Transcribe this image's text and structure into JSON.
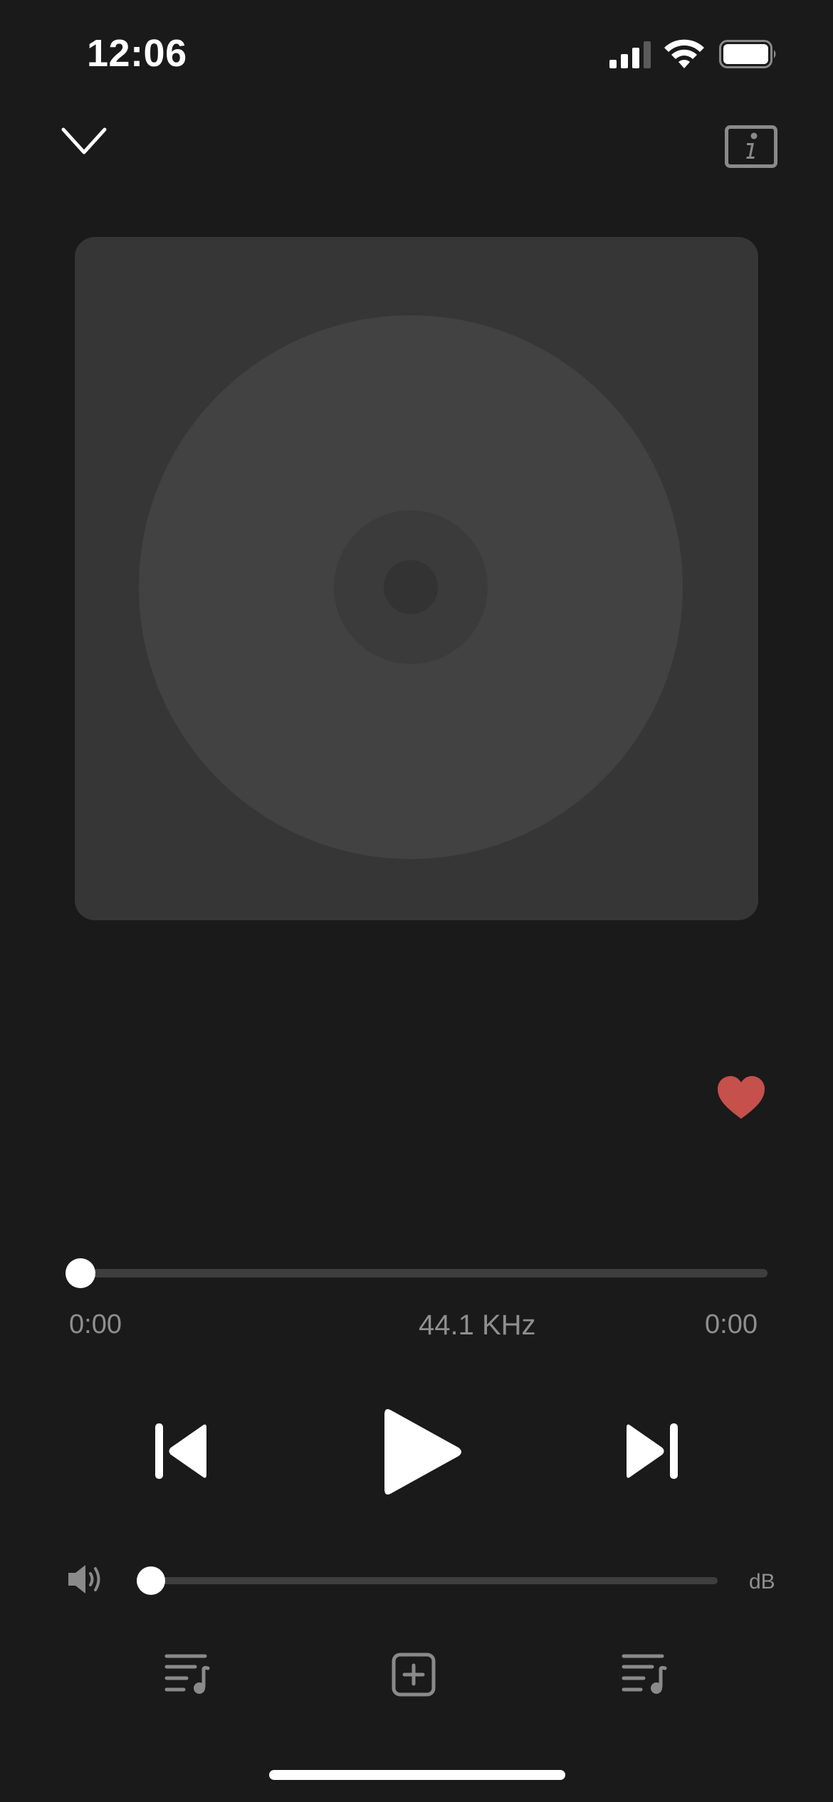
{
  "status_bar": {
    "time": "12:06",
    "icons": [
      "signal-icon",
      "wifi-icon",
      "battery-icon"
    ]
  },
  "nav": {
    "collapse_icon": "chevron-down-icon",
    "info_icon": "info-icon"
  },
  "album_art": {
    "placeholder_icon": "disc-icon"
  },
  "favorite": {
    "icon": "heart-icon",
    "color": "#c5504c"
  },
  "playback": {
    "elapsed": "0:00",
    "sample_rate": "44.1 KHz",
    "total": "0:00",
    "progress": 0
  },
  "transport": {
    "previous_icon": "skip-back-icon",
    "play_icon": "play-icon",
    "next_icon": "skip-forward-icon"
  },
  "volume": {
    "icon": "speaker-icon",
    "level": 0,
    "unit_label": "dB"
  },
  "bottom_bar": {
    "left_icon": "playlist-icon",
    "center_icon": "add-icon",
    "right_icon": "queue-icon"
  },
  "colors": {
    "background": "#1a1a1a",
    "art_background": "#363636",
    "disc": "#424242",
    "secondary_text": "#8f8f8f",
    "accent_heart": "#c5504c"
  }
}
